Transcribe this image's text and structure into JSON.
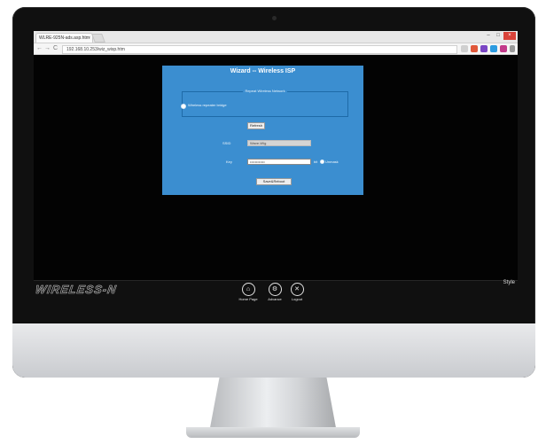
{
  "browser": {
    "tab_title": "WLRE-925N-ads.asp.htm",
    "tab_close": "×",
    "url": "192.168.10.253/wiz_wisp.htm",
    "back": "←",
    "forward": "→",
    "reload": "C",
    "win_min": "–",
    "win_max": "□",
    "win_close": "×",
    "colors": {
      "accent_red": "#d9433a"
    }
  },
  "wizard": {
    "title": "Wizard -- Wireless ISP",
    "legend": "Repeat Wireless Network",
    "option_label": "Wireless repeater bridge",
    "refresh_label": "Refresh",
    "ssid_label": "SSID",
    "ssid_value": "Wave-Wig",
    "key_label": "Key",
    "key_value": "••••••••••••",
    "key_suffix": "bit",
    "unmask_label": "Unmask",
    "submit_label": "Save&Reboot",
    "colors": {
      "panel": "#3b8ed0"
    }
  },
  "footer": {
    "brand": "WIRELESS-N",
    "style_link": "Style",
    "nav": [
      {
        "label": "Home Page",
        "icon": "home-icon",
        "glyph": "⌂"
      },
      {
        "label": "Advance",
        "icon": "gear-icon",
        "glyph": "⚙"
      },
      {
        "label": "Logout",
        "icon": "close-icon",
        "glyph": "✕"
      }
    ]
  }
}
